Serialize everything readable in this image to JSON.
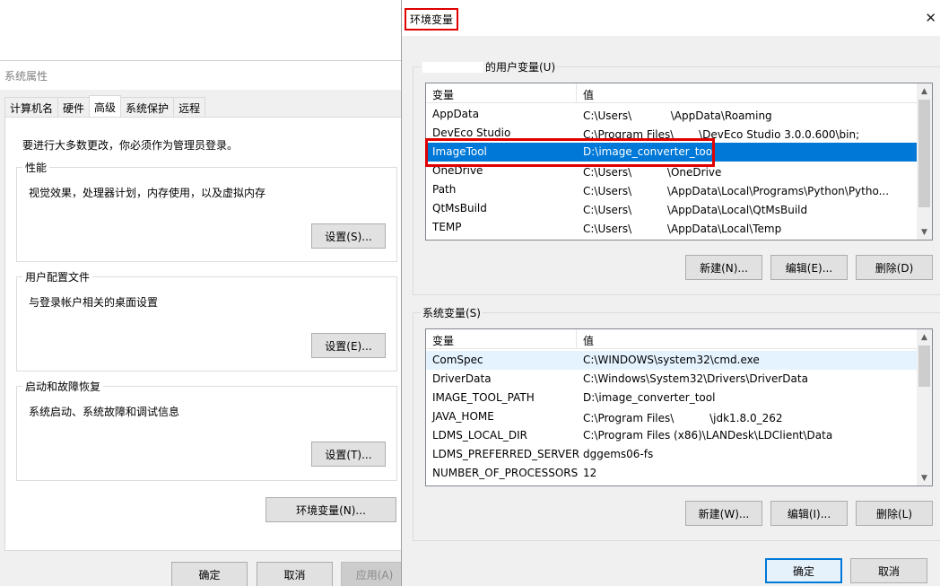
{
  "sysprops": {
    "title": "系统属性",
    "tabs": [
      "计算机名",
      "硬件",
      "高级",
      "系统保护",
      "远程"
    ],
    "active_tab": "高级",
    "admin_note": "要进行大多数更改，你必须作为管理员登录。",
    "performance": {
      "legend": "性能",
      "desc": "视觉效果，处理器计划，内存使用，以及虚拟内存",
      "button": "设置(S)..."
    },
    "profiles": {
      "legend": "用户配置文件",
      "desc": "与登录帐户相关的桌面设置",
      "button": "设置(E)..."
    },
    "startup": {
      "legend": "启动和故障恢复",
      "desc": "系统启动、系统故障和调试信息",
      "button": "设置(T)..."
    },
    "env_button": "环境变量(N)...",
    "ok": "确定",
    "cancel": "取消",
    "apply": "应用(A)"
  },
  "envdlg": {
    "title": "环境变量",
    "close_glyph": "✕",
    "user_section": {
      "legend": "的用户变量(U)",
      "col_var": "变量",
      "col_val": "值",
      "rows": [
        {
          "name": "AppData",
          "value": "C:\\Users\\ 　　　 \\AppData\\Roaming"
        },
        {
          "name": "DevEco Studio",
          "value": "C:\\Program Files\\　　 \\DevEco Studio 3.0.0.600\\bin;"
        },
        {
          "name": "ImageTool",
          "value": "D:\\image_converter_tool"
        },
        {
          "name": "OneDrive",
          "value": "C:\\Users\\　　　 \\OneDrive"
        },
        {
          "name": "Path",
          "value": "C:\\Users\\　　　 \\AppData\\Local\\Programs\\Python\\Pytho..."
        },
        {
          "name": "QtMsBuild",
          "value": "C:\\Users\\　　　 \\AppData\\Local\\QtMsBuild"
        },
        {
          "name": "TEMP",
          "value": "C:\\Users\\　　　 \\AppData\\Local\\Temp"
        }
      ],
      "new_btn": "新建(N)...",
      "edit_btn": "编辑(E)...",
      "delete_btn": "删除(D)"
    },
    "sys_section": {
      "legend": "系统变量(S)",
      "col_var": "变量",
      "col_val": "值",
      "rows": [
        {
          "name": "ComSpec",
          "value": "C:\\WINDOWS\\system32\\cmd.exe"
        },
        {
          "name": "DriverData",
          "value": "C:\\Windows\\System32\\Drivers\\DriverData"
        },
        {
          "name": "IMAGE_TOOL_PATH",
          "value": "D:\\image_converter_tool"
        },
        {
          "name": "JAVA_HOME",
          "value": "C:\\Program Files\\　　　 \\jdk1.8.0_262"
        },
        {
          "name": "LDMS_LOCAL_DIR",
          "value": "C:\\Program Files (x86)\\LANDesk\\LDClient\\Data"
        },
        {
          "name": "LDMS_PREFERRED_SERVER",
          "value": "dggems06-fs"
        },
        {
          "name": "NUMBER_OF_PROCESSORS",
          "value": "12"
        }
      ],
      "new_btn": "新建(W)...",
      "edit_btn": "编辑(I)...",
      "delete_btn": "删除(L)"
    },
    "ok": "确定",
    "cancel": "取消"
  },
  "colors": {
    "selection": "#0078d7",
    "highlight_box": "#e00000",
    "dialog_bg": "#f0f0f0"
  }
}
